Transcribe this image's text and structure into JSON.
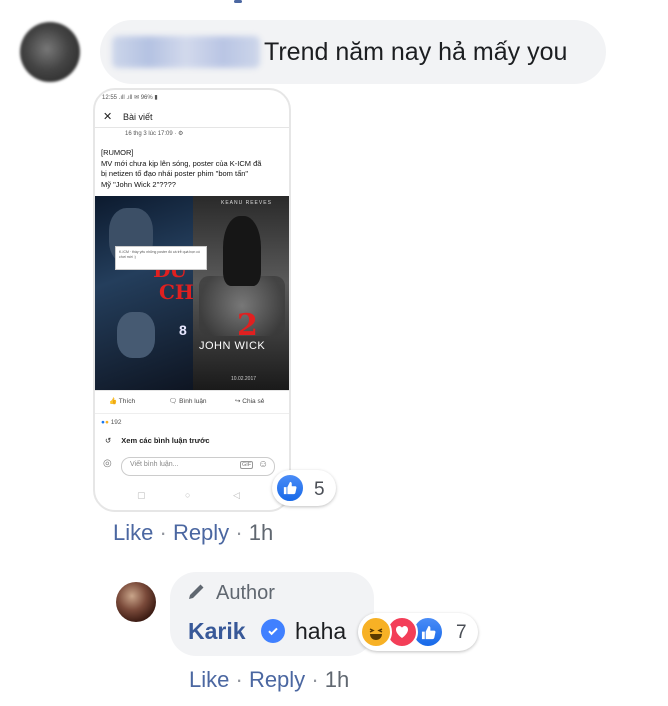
{
  "comment": {
    "text": "Trend năm nay hả mấy you",
    "reaction_count": "5",
    "actions": {
      "like": "Like",
      "reply": "Reply",
      "separator": "·",
      "time": "1h"
    }
  },
  "screenshot_post": {
    "status_bar": "12:55 .ıll .ıll ✉ 96% ▮",
    "header_title": "Bài viết",
    "meta": "16 thg 3 lúc 17:09 · ⚙",
    "body_lines": [
      "[RUMOR]",
      "MV mới chưa kịp lên sóng, poster của K-ICM đã",
      "bị netizen tố đạo nhái poster phim \"bom tấn\"",
      "Mỹ \"John Wick 2\"????"
    ],
    "poster_left_title": "ĐỪ",
    "poster_left_title2": "CH",
    "poster_left_number": "8",
    "poster_right_top": "KEANU REEVES",
    "poster_right_number": "2",
    "poster_right_title": "JOHN WICK",
    "poster_right_date": "10.02.2017",
    "embed_text": "K-ICM · thầy yêu những poster đó cá trễ quá bọn có chơi mời :)",
    "action_like": "Thích",
    "action_comment": "Bình luận",
    "action_share": "Chia sẻ",
    "reaction_summary": "192",
    "view_previous": "Xem các bình luận trước",
    "input_placeholder": "Viết bình luận...",
    "gif_label": "GIF"
  },
  "reply": {
    "badge": "Author",
    "author_name": "Karik",
    "text": "haha",
    "reaction_count": "7",
    "actions": {
      "like": "Like",
      "reply": "Reply",
      "separator": "·",
      "time": "1h"
    }
  },
  "colors": {
    "link": "#4b67a1",
    "name": "#385898",
    "bubble": "#f2f3f5",
    "like_blue": "#1877f2",
    "love_red": "#f33e58",
    "haha_yellow": "#f7b125"
  },
  "icons": [
    "like-icon",
    "love-icon",
    "haha-icon",
    "verified-icon",
    "pencil-icon",
    "close-icon",
    "camera-icon",
    "smile-icon",
    "share-icon",
    "comment-icon"
  ]
}
